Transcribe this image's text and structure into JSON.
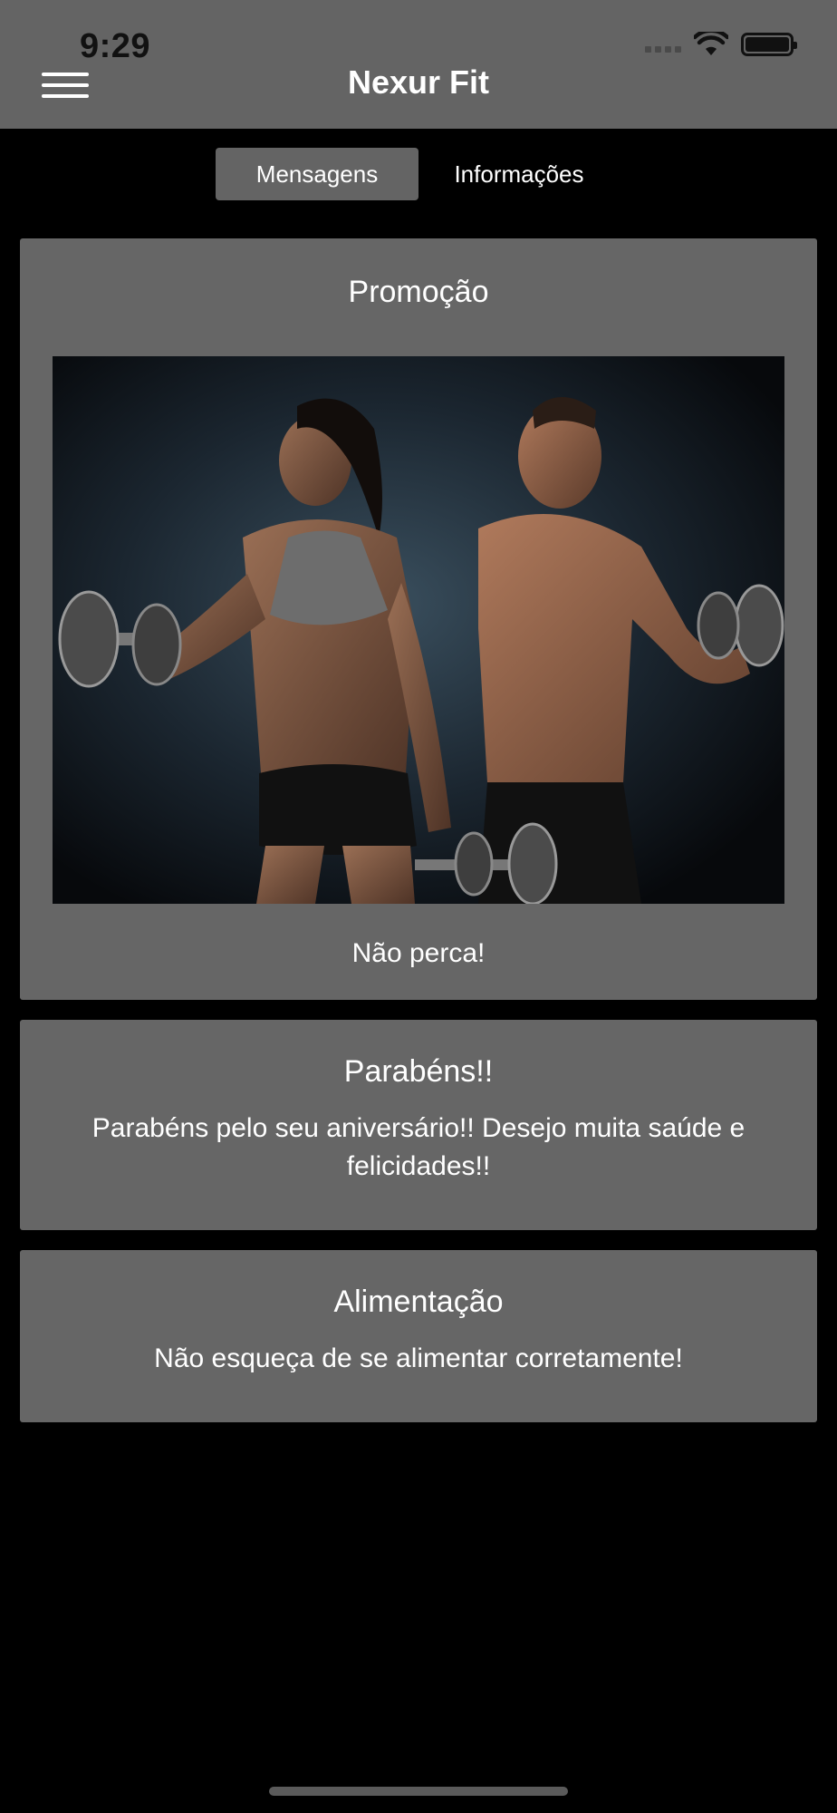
{
  "status": {
    "time": "9:29"
  },
  "header": {
    "title": "Nexur Fit"
  },
  "tabs": [
    {
      "label": "Mensagens",
      "active": true
    },
    {
      "label": "Informações",
      "active": false
    }
  ],
  "messages": [
    {
      "title": "Promoção",
      "body": "Não perca!"
    },
    {
      "title": "Parabéns!!",
      "body": "Parabéns pelo seu aniversário!! Desejo muita saúde e felicidades!!"
    },
    {
      "title": "Alimentação",
      "body": "Não esqueça de se alimentar corretamente!"
    }
  ],
  "colors": {
    "bar": "#646464",
    "card": "#666666",
    "background": "#000000"
  }
}
